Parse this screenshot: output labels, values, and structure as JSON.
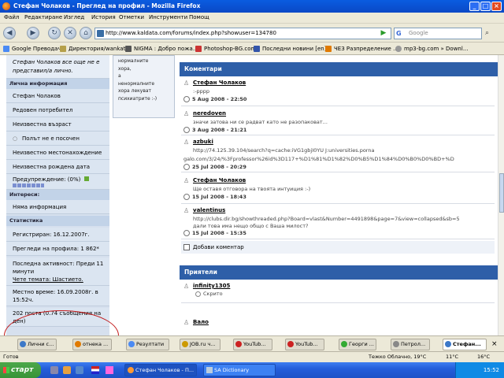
{
  "window": {
    "title": "Стефан Чолаков - Преглед на профил - Mozilla Firefox"
  },
  "menu": [
    "Файл",
    "Редактиране",
    "Изглед",
    "История",
    "Отметки",
    "Инструменти",
    "Помощ"
  ],
  "nav": {
    "url": "http://www.kaldata.com/forums/index.php?showuser=134780",
    "search_placeholder": "Google",
    "search_logo": "G"
  },
  "bookmarks": [
    "Google Преводач",
    "Директория/wankata",
    "NIGMA : Добро пожа...",
    "Photoshop-BG.com",
    "Последни новини [en]",
    "ЧЕЗ Разпределение ...",
    "mp3-bg.com » Downl..."
  ],
  "left": {
    "top_text_1": "Стефан Чолаков все още не е",
    "top_text_2": "представил/а личнo.",
    "sections": [
      {
        "header": "Лична информация",
        "rows": [
          "Стефан Чолаков",
          "Редовен потребител",
          "Неизвестна възраст",
          "Полът не е посочен",
          "Неизвестно местонахождение",
          "Неизвестна рождена дата",
          "Предупреждение: (0%)"
        ]
      },
      {
        "header": "Интереси:",
        "rows": [
          "Няма информация"
        ]
      },
      {
        "header": "Статистика",
        "rows": [
          "Регистриран: 16.12.2007г.",
          "Прегледи на профила: 1 862*",
          "Последна активност: Преди 11",
          "минути",
          "Чете темата: Шастието.",
          "Местно време: 16.09.2008г. в",
          "15:52ч.",
          "202 поста (0.74 съобщения на",
          "ден)"
        ]
      }
    ]
  },
  "mid": {
    "lines": [
      "нормалните",
      "хора,",
      "а",
      "ненормалните",
      "хора лекуват",
      "психиатрите :-)"
    ]
  },
  "comments": {
    "header": "Коментари",
    "items": [
      {
        "author": "Стефан Чолаков",
        "body": ":-рррр",
        "date": "5 Aug 2008 - 22:50"
      },
      {
        "author": "neredoven",
        "body": "значи затова ни се радват като не разопаковат...",
        "date": "3 Aug 2008 - 21:21"
      },
      {
        "author": "azbuki",
        "body": "http://74.125.39.104/search?q=cache:iVG1gbjI0YU J:universities.porna",
        "body2": "galo.com/3/24/%3Fprofessor%26id%3D117+%D1%81%D1%82%D0%B5%D1%84%D0%B0%D0%BD+%D",
        "date": "25 Jul 2008 - 20:29"
      },
      {
        "author": "Стефан Чолаков",
        "body": "Ще оставя отговора на твоята интуиция :-)",
        "date": "15 Jul 2008 - 18:43"
      },
      {
        "author": "valentinus",
        "body": "http://clubs.dir.bg/showthreaded.php?Board=vlast&Number=4491898&page=7&view=collapsed&sb=5",
        "body2": "дали това има нещо общо с Ваша милост?",
        "date": "15 Jul 2008 - 15:35"
      }
    ],
    "add_label": "Добави коментар"
  },
  "friends": {
    "header": "Приятели",
    "items": [
      {
        "name": "infinity1305",
        "status": "Скрито"
      },
      {
        "name": "Вало"
      }
    ]
  },
  "tabs": [
    "Лични с...",
    "отнека ...",
    "Резултати",
    "JOB.ru ч...",
    "YouTub...",
    "YouTub...",
    "Георги ...",
    "Петрол...",
    "Стефан..."
  ],
  "status": {
    "left": "Готов",
    "weather": "Тежко Облачно, 19°C",
    "temp1": "11°C",
    "temp2": "16°C"
  },
  "taskbar": {
    "start": "старт",
    "tasks": [
      "Стефан Чолаков - П...",
      "SA Dictionary"
    ],
    "time": "15:52"
  }
}
